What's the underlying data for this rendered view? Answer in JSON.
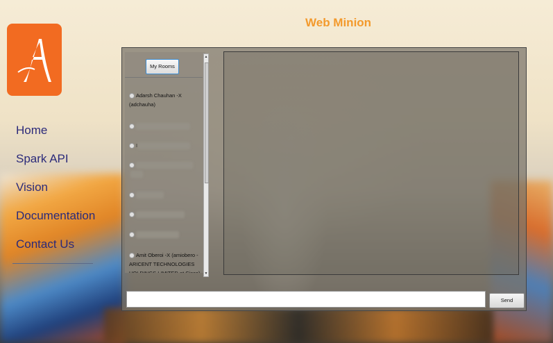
{
  "app_title": "Web Minion",
  "nav": {
    "items": [
      "Home",
      "Spark API",
      "Vision",
      "Documentation",
      "Contact Us"
    ]
  },
  "rooms": {
    "button_label": "My Rooms",
    "items": [
      {
        "text": "Adarsh Chauhan -X (adchauha)"
      },
      {
        "text": "I"
      },
      {
        "text": ""
      },
      {
        "text": ""
      },
      {
        "text": ""
      },
      {
        "text": ""
      },
      {
        "text": ""
      },
      {
        "text": "Amit Oberoi -X (amiobero - ARICENT TECHNOLOGIES HOLDINGS LIMITED at Cisco)"
      }
    ]
  },
  "composer": {
    "input_value": "",
    "send_label": "Send"
  },
  "colors": {
    "logo": "#f26b21",
    "title": "#f39a2c",
    "nav_text": "#2b2a7a"
  }
}
